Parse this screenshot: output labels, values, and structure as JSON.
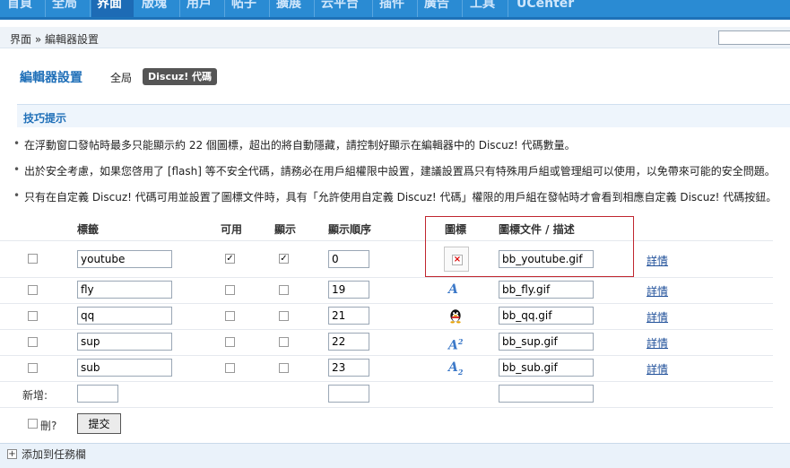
{
  "nav": {
    "tabs": [
      "首頁",
      "全局",
      "界面",
      "版塊",
      "用戶",
      "帖子",
      "擴展",
      "云平台",
      "插件",
      "廣告",
      "工具",
      "UCenter"
    ],
    "active_index": 2
  },
  "breadcrumb": "界面 » 編輯器設置",
  "title": "編輯器設置",
  "subtabs": {
    "global": "全局",
    "discuz": "Discuz! 代碼"
  },
  "tips": {
    "heading": "技巧提示",
    "items": [
      "在浮動窗口發帖時最多只能顯示約 22 個圖標，超出的將自動隱藏，請控制好顯示在編輯器中的 Discuz! 代碼數量。",
      "出於安全考慮，如果您啓用了 [flash] 等不安全代碼，請務必在用戶組權限中設置，建議設置爲只有特殊用戶組或管理組可以使用，以免帶來可能的安全問題。",
      "只有在自定義 Discuz! 代碼可用並設置了圖標文件時，具有「允許使用自定義 Discuz! 代碼」權限的用戶組在發帖時才會看到相應自定義 Discuz! 代碼按鈕。"
    ]
  },
  "table": {
    "headers": {
      "tag": "標籤",
      "available": "可用",
      "display": "顯示",
      "order": "顯示順序",
      "icon": "圖標",
      "icon_file": "圖標文件 / 描述"
    },
    "rows": [
      {
        "tag": "youtube",
        "available": true,
        "display": true,
        "order": "0",
        "icon": "broken-image-icon",
        "file": "bb_youtube.gif",
        "detail": "詳情"
      },
      {
        "tag": "fly",
        "available": false,
        "display": false,
        "order": "19",
        "icon": "fly-icon",
        "file": "bb_fly.gif",
        "detail": "詳情"
      },
      {
        "tag": "qq",
        "available": false,
        "display": false,
        "order": "21",
        "icon": "qq-penguin-icon",
        "file": "bb_qq.gif",
        "detail": "詳情"
      },
      {
        "tag": "sup",
        "available": false,
        "display": false,
        "order": "22",
        "icon": "superscript-icon",
        "file": "bb_sup.gif",
        "detail": "詳情"
      },
      {
        "tag": "sub",
        "available": false,
        "display": false,
        "order": "23",
        "icon": "subscript-icon",
        "file": "bb_sub.gif",
        "detail": "詳情"
      }
    ],
    "add_label": "新增:",
    "delete_label": "刪?",
    "submit_label": "提交"
  },
  "taskbar": {
    "add_label": "添加到任務欄"
  },
  "colors": {
    "nav_bg": "#2a8bd3",
    "title": "#1f6fb8",
    "highlight_border": "#c0262f"
  }
}
